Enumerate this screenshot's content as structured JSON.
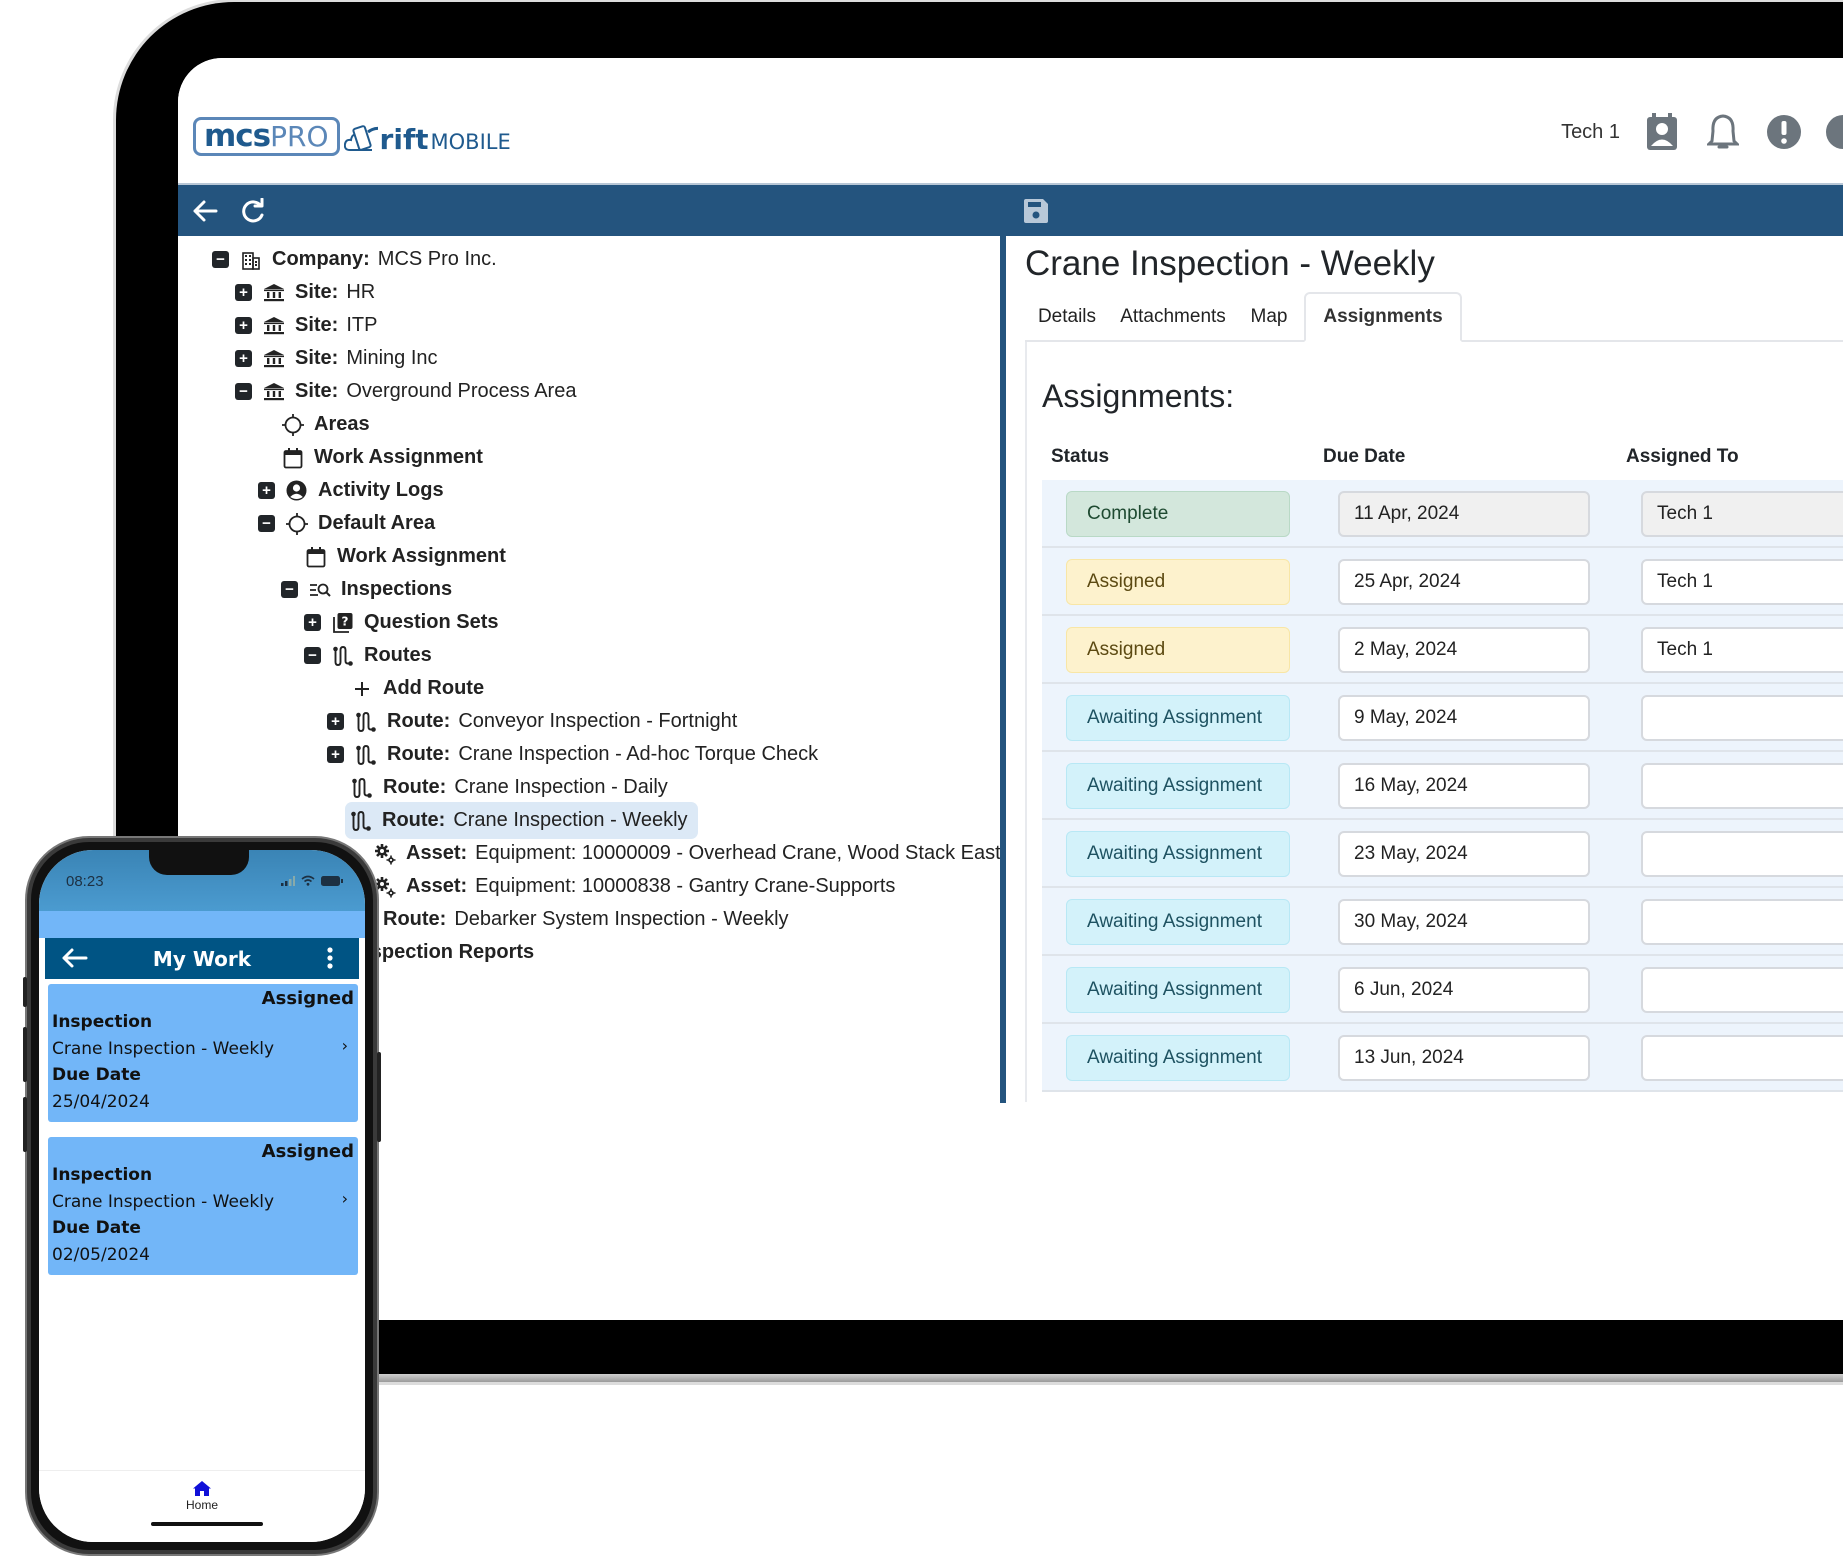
{
  "header": {
    "logo_primary": "mcs",
    "logo_primary_suffix": "PRO",
    "logo_secondary": "rift",
    "logo_secondary_suffix": "MOBILE",
    "user_name": "Tech 1",
    "icons": [
      "contact-calendar-icon",
      "bell-icon",
      "alert-icon"
    ]
  },
  "toolbar": {
    "back_icon": "arrow-left-icon",
    "refresh_icon": "refresh-icon",
    "save_icon": "save-icon"
  },
  "tree": {
    "nodes": [
      {
        "toggle": "minus",
        "icon": "building-icon",
        "label": "Company:",
        "value": "MCS Pro Inc."
      },
      {
        "toggle": "plus",
        "icon": "bank-icon",
        "label": "Site:",
        "value": "HR"
      },
      {
        "toggle": "plus",
        "icon": "bank-icon",
        "label": "Site:",
        "value": "ITP"
      },
      {
        "toggle": "plus",
        "icon": "bank-icon",
        "label": "Site:",
        "value": "Mining Inc"
      },
      {
        "toggle": "minus",
        "icon": "bank-icon",
        "label": "Site:",
        "value": "Overground Process Area"
      },
      {
        "toggle": "",
        "icon": "crosshair-icon",
        "label": "Areas",
        "value": ""
      },
      {
        "toggle": "",
        "icon": "calendar-icon",
        "label": "Work Assignment",
        "value": ""
      },
      {
        "toggle": "plus",
        "icon": "user-circle-icon",
        "label": "Activity Logs",
        "value": ""
      },
      {
        "toggle": "minus",
        "icon": "crosshair-icon",
        "label": "Default Area",
        "value": ""
      },
      {
        "toggle": "",
        "icon": "calendar-icon",
        "label": "Work Assignment",
        "value": ""
      },
      {
        "toggle": "minus",
        "icon": "list-search-icon",
        "label": "Inspections",
        "value": ""
      },
      {
        "toggle": "plus",
        "icon": "question-set-icon",
        "label": "Question Sets",
        "value": ""
      },
      {
        "toggle": "minus",
        "icon": "route-icon",
        "label": "Routes",
        "value": ""
      },
      {
        "toggle": "",
        "icon": "plus-icon",
        "label": "Add Route",
        "value": ""
      },
      {
        "toggle": "plus",
        "icon": "route-icon",
        "label": "Route:",
        "value": "Conveyor Inspection - Fortnight"
      },
      {
        "toggle": "plus",
        "icon": "route-icon",
        "label": "Route:",
        "value": "Crane Inspection - Ad-hoc Torque Check"
      },
      {
        "toggle": "",
        "icon": "route-icon",
        "label": "Route:",
        "value": "Crane Inspection - Daily"
      },
      {
        "toggle": "",
        "icon": "route-icon",
        "label": "Route:",
        "value": "Crane Inspection - Weekly",
        "selected": true
      },
      {
        "toggle": "",
        "icon": "gears-icon",
        "label": "Asset:",
        "value": "Equipment: 10000009 - Overhead Crane, Wood Stack East"
      },
      {
        "toggle": "",
        "icon": "gears-icon",
        "label": "Asset:",
        "value": "Equipment: 10000838 - Gantry Crane-Supports"
      },
      {
        "toggle": "",
        "icon": "route-icon",
        "label": "Route:",
        "value": "Debarker System Inspection - Weekly"
      },
      {
        "toggle": "",
        "icon": "",
        "label": "Inspection Reports",
        "value": ""
      }
    ]
  },
  "detail": {
    "title": "Crane Inspection - Weekly",
    "tabs": [
      {
        "label": "Details",
        "active": false
      },
      {
        "label": "Attachments",
        "active": false
      },
      {
        "label": "Map",
        "active": false
      },
      {
        "label": "Assignments",
        "active": true
      }
    ],
    "section_title": "Assignments:",
    "columns": [
      "Status",
      "Due Date",
      "Assigned To"
    ],
    "rows": [
      {
        "status": "Complete",
        "status_kind": "complete",
        "due_date": "11 Apr, 2024",
        "assigned_to": "Tech 1",
        "readonly": true
      },
      {
        "status": "Assigned",
        "status_kind": "assigned",
        "due_date": "25 Apr, 2024",
        "assigned_to": "Tech 1",
        "readonly": false
      },
      {
        "status": "Assigned",
        "status_kind": "assigned",
        "due_date": "2 May, 2024",
        "assigned_to": "Tech 1",
        "readonly": false
      },
      {
        "status": "Awaiting Assignment",
        "status_kind": "awaiting",
        "due_date": "9 May, 2024",
        "assigned_to": "",
        "readonly": false
      },
      {
        "status": "Awaiting Assignment",
        "status_kind": "awaiting",
        "due_date": "16 May, 2024",
        "assigned_to": "",
        "readonly": false
      },
      {
        "status": "Awaiting Assignment",
        "status_kind": "awaiting",
        "due_date": "23 May, 2024",
        "assigned_to": "",
        "readonly": false
      },
      {
        "status": "Awaiting Assignment",
        "status_kind": "awaiting",
        "due_date": "30 May, 2024",
        "assigned_to": "",
        "readonly": false
      },
      {
        "status": "Awaiting Assignment",
        "status_kind": "awaiting",
        "due_date": "6 Jun, 2024",
        "assigned_to": "",
        "readonly": false
      },
      {
        "status": "Awaiting Assignment",
        "status_kind": "awaiting",
        "due_date": "13 Jun, 2024",
        "assigned_to": "",
        "readonly": false
      }
    ]
  },
  "phone": {
    "time": "08:23",
    "title": "My Work",
    "cards": [
      {
        "status": "Assigned",
        "label1": "Inspection",
        "value1": "Crane Inspection - Weekly",
        "label2": "Due Date",
        "value2": "25/04/2024"
      },
      {
        "status": "Assigned",
        "label1": "Inspection",
        "value1": "Crane Inspection - Weekly",
        "label2": "Due Date",
        "value2": "02/05/2024"
      }
    ],
    "tab_home": "Home"
  },
  "colors": {
    "brand_blue": "#24547e",
    "phone_appbar": "#005484",
    "phone_card": "#72b6f8",
    "status_complete": "#d3e7dc",
    "status_assigned": "#fdf2cd",
    "status_awaiting": "#d3f2fa",
    "selected_row": "#dce9f6"
  }
}
